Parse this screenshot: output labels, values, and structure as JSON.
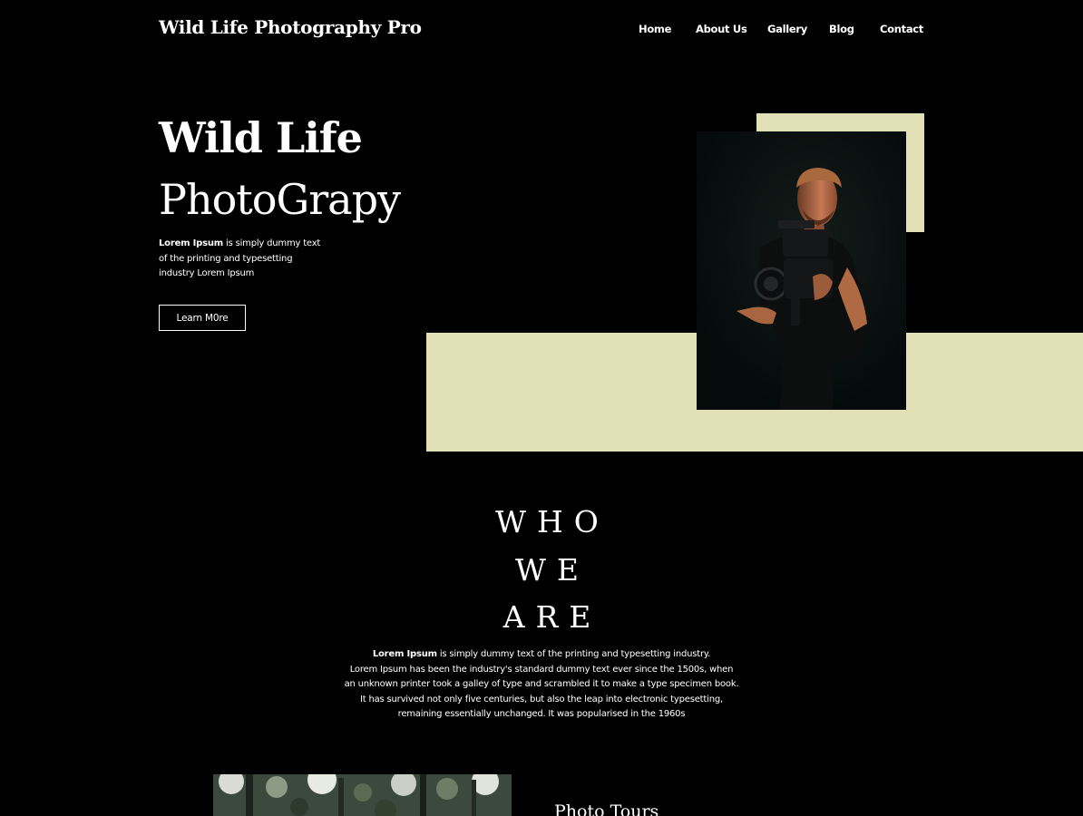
{
  "header": {
    "brand": "Wild Life Photography Pro",
    "nav": [
      "Home",
      "About Us",
      "Gallery",
      "Blog",
      "Contact"
    ]
  },
  "hero": {
    "title_line1": "Wild Life",
    "title_line2": "PhotoGrapy",
    "desc_bold": "Lorem Ipsum",
    "desc_line1": " is simply dummy text",
    "desc_line2": "of the printing and typesetting",
    "desc_line3": "industry Lorem Ipsum",
    "button": "Learn M0re"
  },
  "about": {
    "heading_lines": [
      "WHO",
      "WE",
      "ARE"
    ],
    "bold": "Lorem Ipsum",
    "line1": " is simply dummy text of the printing and typesetting industry.",
    "line2": "Lorem Ipsum has been the industry's standard dummy text ever since the 1500s, when",
    "line3": "an unknown printer took a galley of type and scrambled it to make a type specimen book.",
    "line4": "It has survived not only five centuries, but also the leap into electronic typesetting,",
    "line5": "remaining essentially unchanged. It was popularised in the 1960s"
  },
  "tours": {
    "title": "Photo Tours"
  },
  "colors": {
    "background": "#000000",
    "accent": "#e1e0b7",
    "photo_bg": "#071110"
  }
}
